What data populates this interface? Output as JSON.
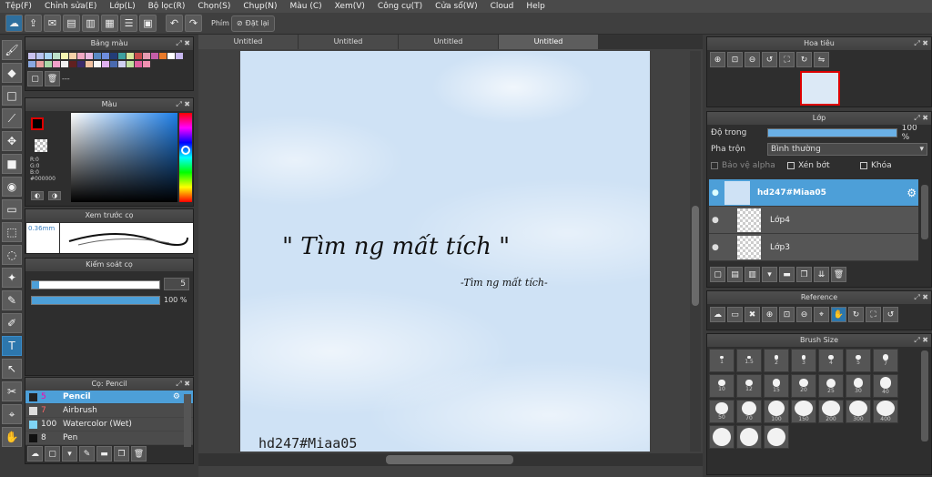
{
  "menu": [
    "Tệp(F)",
    "Chỉnh sửa(E)",
    "Lớp(L)",
    "Bộ lọc(R)",
    "Chọn(S)",
    "Chụp(N)",
    "Màu (C)",
    "Xem(V)",
    "Công cụ(T)",
    "Cửa sổ(W)",
    "Cloud",
    "Help"
  ],
  "toolbar": {
    "brush_label": "Phím",
    "reset_label": "Đặt lại"
  },
  "palette": {
    "title": "Bảng màu",
    "dots": "---",
    "colors": [
      "#c9c3f0",
      "#b7c4f0",
      "#a9d5f5",
      "#bde0c8",
      "#f5f5b0",
      "#f6d2a9",
      "#f0a9c3",
      "#e9b9e0",
      "#5a8ac4",
      "#6e8ddc",
      "#233d78",
      "#3da0a0",
      "#d7e59b",
      "#c84d4d",
      "#e59bb0",
      "#c45ea8",
      "#e87a2a",
      "#ffffff",
      "#c8b8f0",
      "#8aa8e0",
      "#e8a0a0",
      "#a8d8a8",
      "#f0a0c8",
      "#f0f0f0",
      "#602020",
      "#3a2a6a",
      "#f0c0a0",
      "#f8f8f8",
      "#e0b0f0",
      "#4a6ab0",
      "#d0d0f0",
      "#c0e0a0",
      "#e060a0",
      "#f090b0"
    ]
  },
  "color": {
    "title": "Màu",
    "r": "R:0",
    "g": "G:0",
    "b": "B:0",
    "hex": "#000000"
  },
  "preview": {
    "title": "Xem trước cọ",
    "size": "0.36mm"
  },
  "brushctl": {
    "title": "Kiểm soát cọ",
    "size_value": "5",
    "opacity": "100 %",
    "opacity_fraction": 1.0
  },
  "brushes": {
    "title": "Cọ: Pencil",
    "items": [
      {
        "size": "5",
        "name": "Pencil"
      },
      {
        "size": "7",
        "name": "Airbrush"
      },
      {
        "size": "100",
        "name": "Watercolor (Wet)"
      },
      {
        "size": "8",
        "name": "Pen"
      }
    ]
  },
  "tabs": [
    "Untitled",
    "Untitled",
    "Untitled",
    "Untitled"
  ],
  "canvas": {
    "title_text": "\" Tìm ng mất tích \"",
    "subtitle_text": "-Tìm ng mất tích-",
    "watermark": "hd247#Miaa05"
  },
  "navigator": {
    "title": "Hoa tiêu"
  },
  "layers": {
    "title": "Lớp",
    "opacity_label": "Độ trong",
    "opacity_value": "100 %",
    "opacity_fraction": 1.0,
    "blend_label": "Pha trộn",
    "blend_value": "Bình thường",
    "protect_alpha": "Bảo vệ alpha",
    "clipping": "Xén bớt",
    "lock": "Khóa",
    "items": [
      "hd247#Miaa05",
      "Lớp4",
      "Lớp3"
    ]
  },
  "reference": {
    "title": "Reference"
  },
  "brushsize": {
    "title": "Brush Size",
    "sizes": [
      "1",
      "1.5",
      "2",
      "3",
      "4",
      "5",
      "7",
      "10",
      "12",
      "15",
      "20",
      "25",
      "30",
      "40",
      "50",
      "70",
      "100",
      "150",
      "200",
      "300",
      "400",
      "",
      "",
      ""
    ]
  }
}
